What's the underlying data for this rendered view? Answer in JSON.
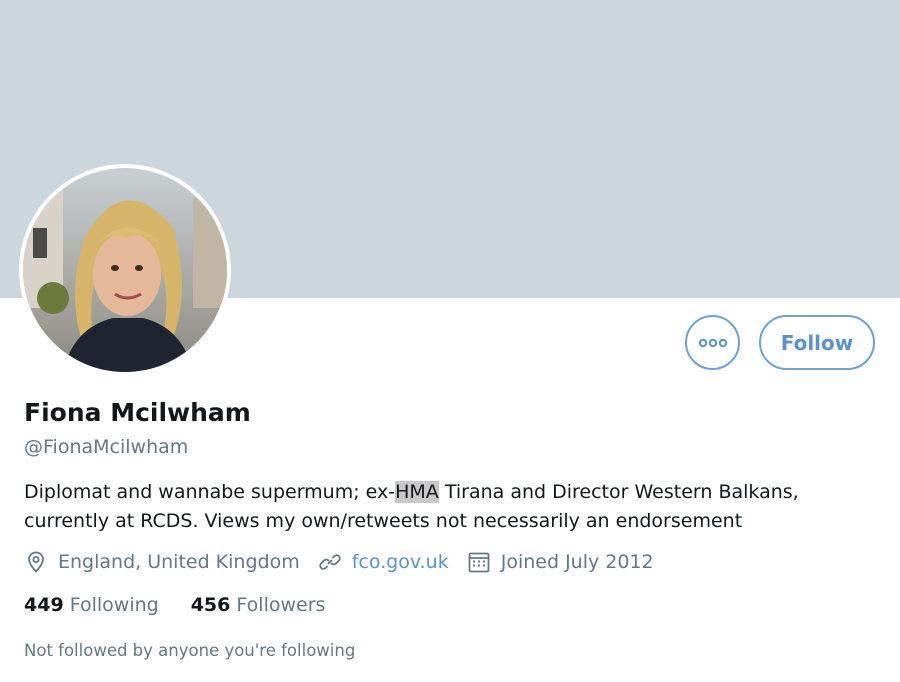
{
  "profile": {
    "name": "Fiona Mcilwham",
    "handle": "@FionaMcilwham",
    "bio_before": "Diplomat and wannabe supermum; ex-",
    "bio_highlight": "HMA",
    "bio_after": " Tirana and Director Western Balkans, currently at RCDS. Views my own/retweets not necessarily an endorsement",
    "location": "England, United Kingdom",
    "website": "fco.gov.uk",
    "joined": "Joined July 2012"
  },
  "stats": {
    "following_count": "449",
    "following_label": "Following",
    "followers_count": "456",
    "followers_label": "Followers"
  },
  "actions": {
    "follow_label": "Follow",
    "more_icon": "more-icon"
  },
  "footer": {
    "note": "Not followed by anyone you're following"
  },
  "colors": {
    "banner": "#ccd6dd",
    "accent": "#5b93c8",
    "highlight": "#c8c8c8"
  }
}
